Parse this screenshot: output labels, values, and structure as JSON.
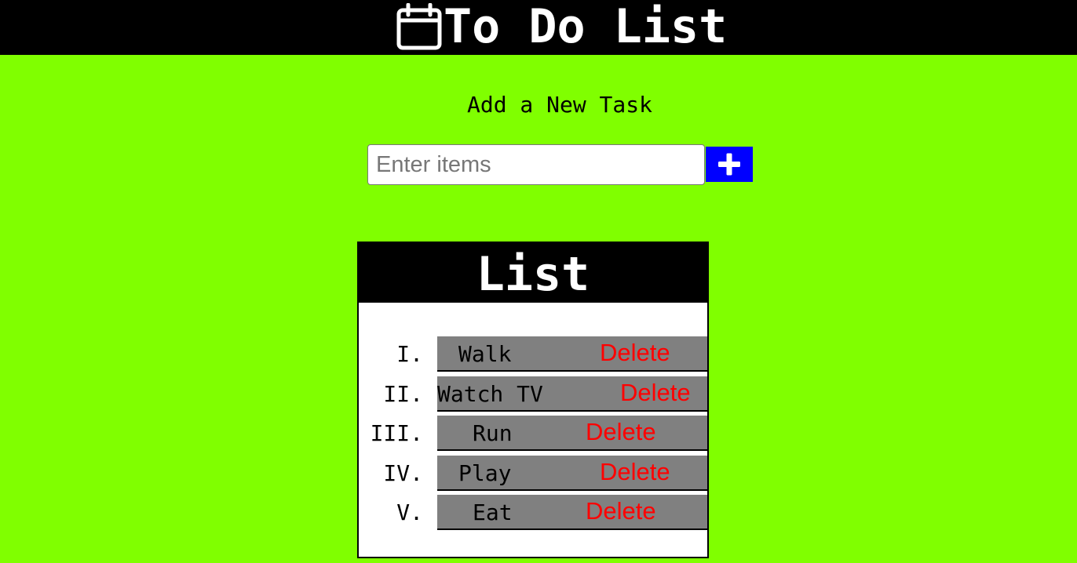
{
  "header": {
    "title": "To Do List",
    "icon": "calendar-icon"
  },
  "form": {
    "heading": "Add a New Task",
    "input_placeholder": "Enter items",
    "add_button_icon": "plus-icon",
    "add_button_color": "#0000ff"
  },
  "list": {
    "heading": "List",
    "items": [
      {
        "numeral": "I.",
        "text": "Walk",
        "delete_label": "Delete"
      },
      {
        "numeral": "II.",
        "text": "Watch TV",
        "delete_label": "Delete"
      },
      {
        "numeral": "III.",
        "text": "Run",
        "delete_label": "Delete"
      },
      {
        "numeral": "IV.",
        "text": "Play",
        "delete_label": "Delete"
      },
      {
        "numeral": "V.",
        "text": "Eat",
        "delete_label": "Delete"
      }
    ]
  },
  "colors": {
    "background": "#80ff00",
    "header": "#000000",
    "item_bar": "#808080",
    "delete": "#ff0000"
  }
}
